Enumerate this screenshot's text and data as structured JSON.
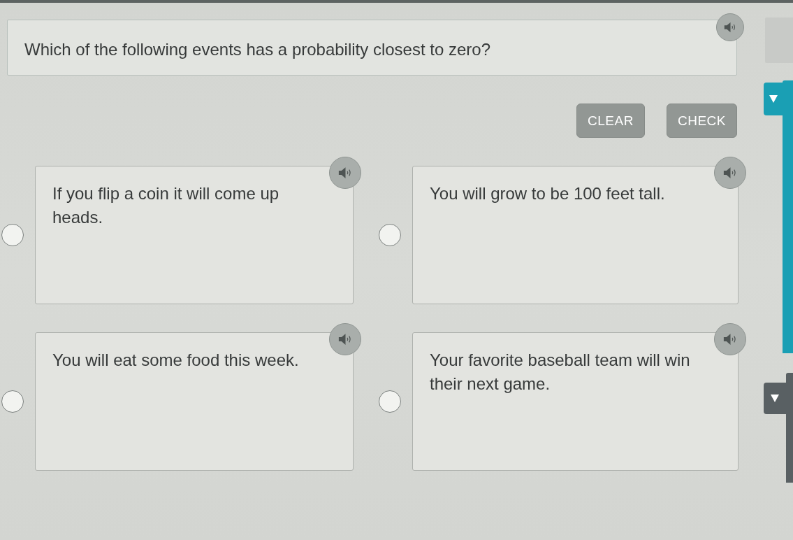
{
  "question": {
    "text": "Which of the following events has a probability closest to zero?"
  },
  "buttons": [
    {
      "label": "CLEAR",
      "disabled": true
    },
    {
      "label": "CHECK",
      "disabled": true
    }
  ],
  "options": [
    {
      "text": "If you flip a coin it will come up heads.",
      "selected": false
    },
    {
      "text": "You will grow to be 100 feet tall.",
      "selected": false
    },
    {
      "text": "You will eat some food this week.",
      "selected": false
    },
    {
      "text": "Your favorite baseball team will win their next game.",
      "selected": false
    }
  ]
}
